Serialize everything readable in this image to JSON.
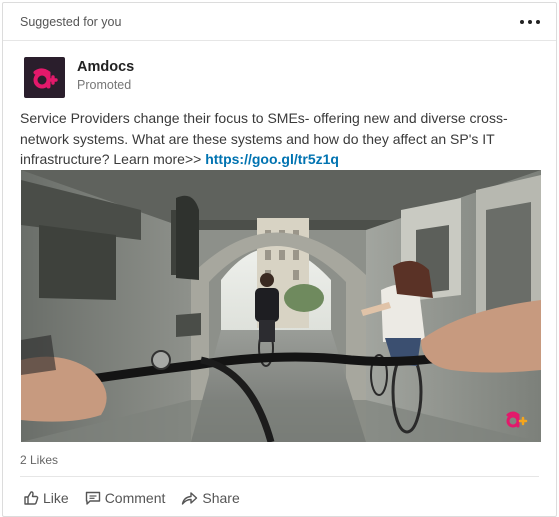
{
  "header": {
    "label": "Suggested for you",
    "more_icon": "more-horizontal-icon"
  },
  "author": {
    "name": "Amdocs",
    "subtitle": "Promoted",
    "logo_icon": "amdocs-logo-icon",
    "brand_color": "#e3196b",
    "logo_bg": "#2a1e2c"
  },
  "post": {
    "text": "Service Providers change their focus to SMEs- offering new and diverse cross-network systems. What are these systems and how do they affect an SP's IT infrastructure? Learn more>> ",
    "link": "https://goo.gl/tr5z1q",
    "link_color": "#0073b1",
    "image_alt": "Cyclists riding through a stone archway in a city street"
  },
  "social": {
    "likes": "2 Likes"
  },
  "actions": {
    "like": {
      "label": "Like",
      "icon": "thumbs-up-icon"
    },
    "comment": {
      "label": "Comment",
      "icon": "comment-icon"
    },
    "share": {
      "label": "Share",
      "icon": "share-arrow-icon"
    }
  }
}
